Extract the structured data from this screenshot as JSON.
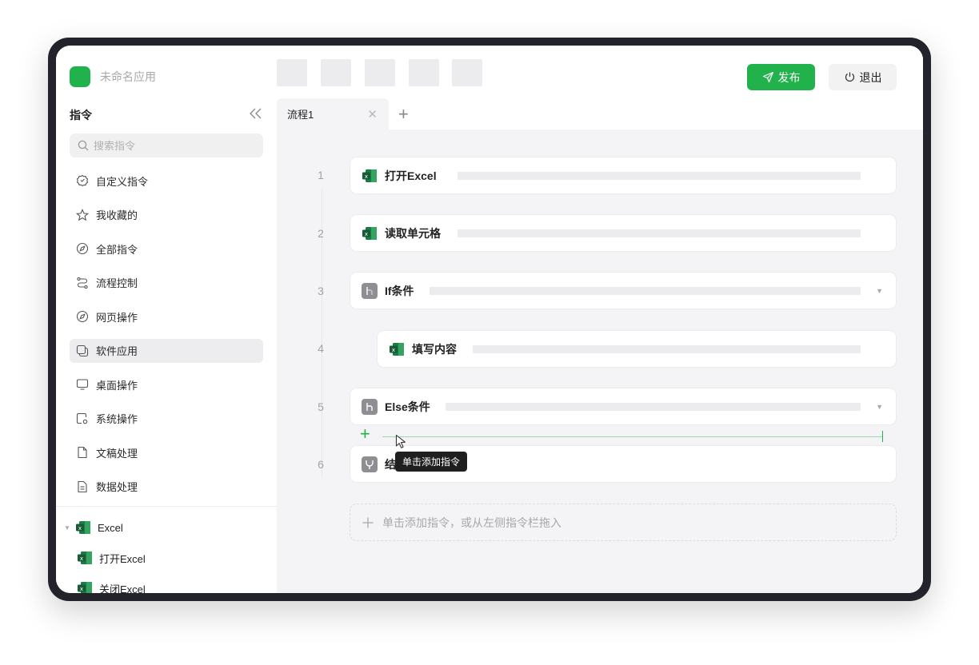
{
  "app": {
    "name": "未命名应用",
    "brand_color": "#22b24c"
  },
  "sidebar": {
    "title": "指令",
    "search_placeholder": "搜索指令",
    "items": [
      {
        "label": "自定义指令",
        "icon": "custom-command-icon"
      },
      {
        "label": "我收藏的",
        "icon": "star-icon"
      },
      {
        "label": "全部指令",
        "icon": "compass-icon"
      },
      {
        "label": "流程控制",
        "icon": "flow-control-icon"
      },
      {
        "label": "网页操作",
        "icon": "compass-icon"
      },
      {
        "label": "软件应用",
        "icon": "software-icon",
        "active": true
      },
      {
        "label": "桌面操作",
        "icon": "monitor-icon"
      },
      {
        "label": "系统操作",
        "icon": "system-gear-icon"
      },
      {
        "label": "文稿处理",
        "icon": "document-icon"
      },
      {
        "label": "数据处理",
        "icon": "data-file-icon"
      }
    ],
    "excel_group": {
      "label": "Excel",
      "children": [
        "打开Excel",
        "关闭Excel"
      ]
    }
  },
  "toolbar": {
    "publish_label": "发布",
    "exit_label": "退出"
  },
  "tabs": [
    {
      "label": "流程1"
    }
  ],
  "steps": [
    {
      "num": "1",
      "label": "打开Excel",
      "icon": "excel-icon"
    },
    {
      "num": "2",
      "label": "读取单元格",
      "icon": "excel-icon"
    },
    {
      "num": "3",
      "label": "If条件",
      "icon": "if-branch-icon"
    },
    {
      "num": "4",
      "label": "填写内容",
      "icon": "excel-icon"
    },
    {
      "num": "5",
      "label": "Else条件",
      "icon": "else-branch-icon"
    },
    {
      "num": "6",
      "label": "结",
      "icon": "end-merge-icon"
    }
  ],
  "tooltip": "单击添加指令",
  "dropzone_text": "单击添加指令，或从左侧指令栏拖入"
}
